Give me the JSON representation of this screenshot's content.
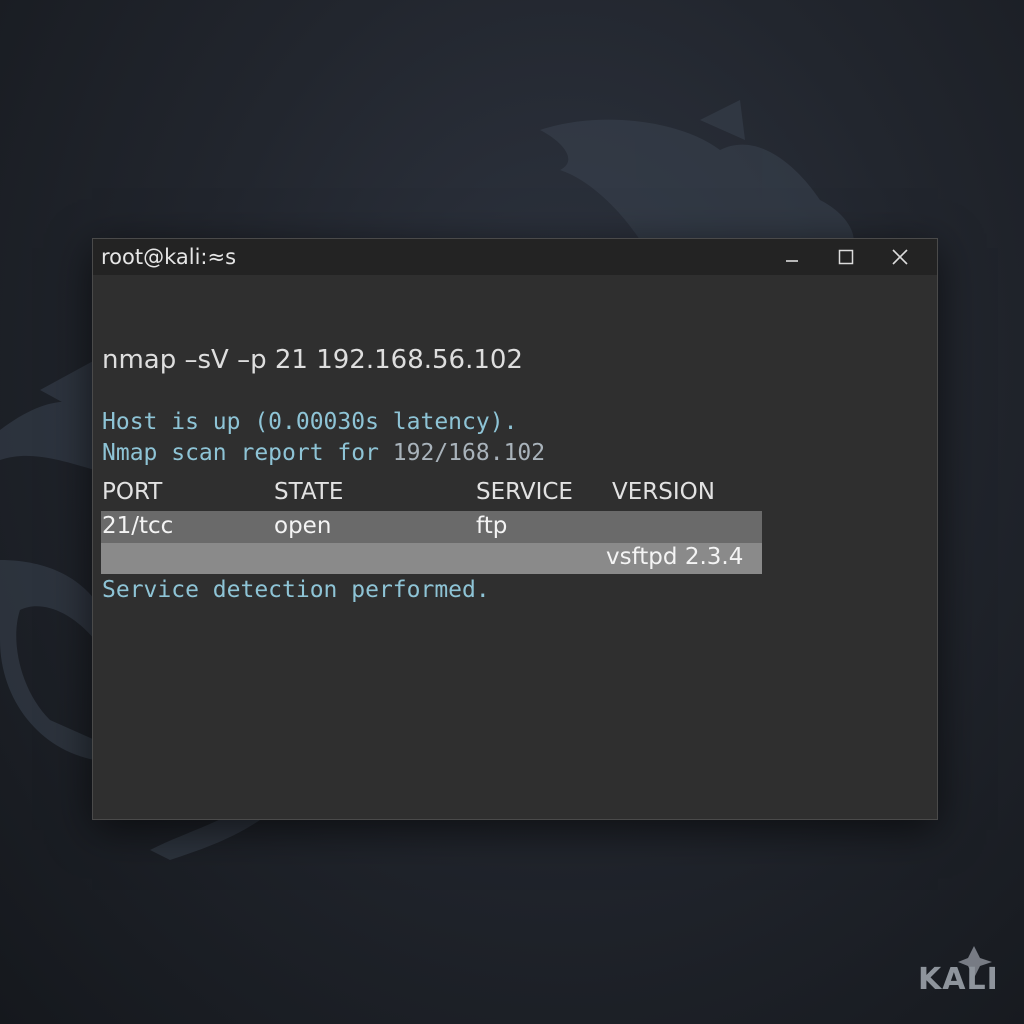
{
  "window": {
    "title": "root@kali:≈s"
  },
  "terminal": {
    "command": "nmap –sV –p 21 192.168.56.102",
    "host_line": "Host is up (0.00030s latency).",
    "report_prefix": "Nmap scan report for ",
    "report_ip": "192/168.102",
    "headers": {
      "port": "PORT",
      "state": "STATE",
      "service": "SERVICE",
      "version": "VERSION"
    },
    "row": {
      "port": "21/tcc",
      "state": "open",
      "service": "ftp",
      "version": "vsftpd 2.3.4"
    },
    "footer_line": "Service detection performed."
  },
  "branding": {
    "logo_text": "KALI"
  },
  "colors": {
    "terminal_bg": "#2f2f2f",
    "titlebar_bg": "#232323",
    "accent_cyan": "#8ec4d6",
    "highlight_row": "#6a6a6a",
    "highlight_row2": "#8a8a8a"
  },
  "icons": [
    "minimize-icon",
    "maximize-icon",
    "close-icon",
    "kali-dragon-icon"
  ]
}
